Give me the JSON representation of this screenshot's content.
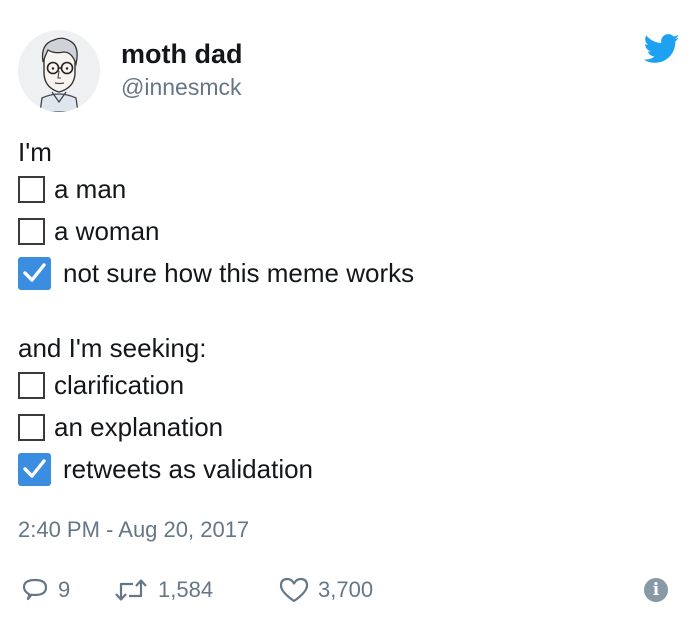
{
  "author": {
    "display_name": "moth dad",
    "handle": "@innesmck"
  },
  "brand": {
    "logo_icon": "twitter-bird-icon",
    "accent": "#1da1f2"
  },
  "tweet": {
    "intro": "I'm",
    "group1": [
      {
        "label": "a man",
        "checked": false
      },
      {
        "label": "a woman",
        "checked": false
      },
      {
        "label": "not sure how this meme works",
        "checked": true
      }
    ],
    "seeking": "and I'm seeking:",
    "group2": [
      {
        "label": "clarification",
        "checked": false
      },
      {
        "label": "an explanation",
        "checked": false
      },
      {
        "label": "retweets as validation",
        "checked": true
      }
    ],
    "checkbox_checked_color": "#3b8de0"
  },
  "timestamp": "2:40 PM - Aug 20, 2017",
  "actions": {
    "replies": "9",
    "retweets": "1,584",
    "likes": "3,700",
    "reply_icon": "reply-bubble-icon",
    "retweet_icon": "retweet-icon",
    "like_icon": "heart-icon",
    "info_icon": "info-icon"
  }
}
